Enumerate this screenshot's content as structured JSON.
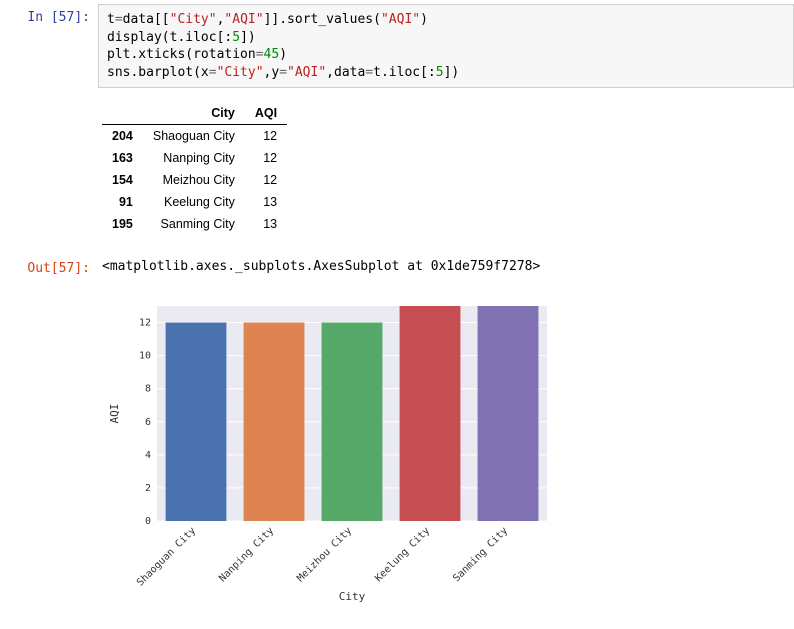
{
  "in_prompt": "In  [57]:",
  "out_prompt": "Out[57]:",
  "code_lines": [
    {
      "pre": "t",
      "op": "=",
      "mid": "data[[",
      "s1": "\"City\"",
      "c": ",",
      "s2": "\"AQI\"",
      "post": "]].sort_values(",
      "s3": "\"AQI\"",
      "end": ")"
    },
    {
      "raw": "display(t.iloc[:",
      "n": "5",
      "end": "])"
    },
    {
      "raw": "plt.xticks(rotation",
      "op": "=",
      "n": "45",
      "end": ")"
    },
    {
      "raw": "sns.barplot(x",
      "op": "=",
      "s1": "\"City\"",
      "c1": ",y",
      "op2": "=",
      "s2": "\"AQI\"",
      "c2": ",data",
      "op3": "=",
      "mid": "t.iloc[:",
      "n": "5",
      "end": "])"
    }
  ],
  "table": {
    "headers": [
      "",
      "City",
      "AQI"
    ],
    "rows": [
      {
        "idx": "204",
        "city": "Shaoguan City",
        "aqi": "12"
      },
      {
        "idx": "163",
        "city": "Nanping City",
        "aqi": "12"
      },
      {
        "idx": "154",
        "city": "Meizhou City",
        "aqi": "12"
      },
      {
        "idx": "91",
        "city": "Keelung City",
        "aqi": "13"
      },
      {
        "idx": "195",
        "city": "Sanming City",
        "aqi": "13"
      }
    ]
  },
  "repr_text": "<matplotlib.axes._subplots.AxesSubplot at 0x1de759f7278>",
  "chart_data": {
    "type": "bar",
    "categories": [
      "Shaoguan City",
      "Nanping City",
      "Meizhou City",
      "Keelung City",
      "Sanming City"
    ],
    "values": [
      12,
      12,
      12,
      13,
      13
    ],
    "title": "",
    "xlabel": "City",
    "ylabel": "AQI",
    "ylim": [
      0,
      13
    ],
    "yticks": [
      0,
      2,
      4,
      6,
      8,
      10,
      12
    ],
    "colors": [
      "#4C72B0",
      "#DD8452",
      "#55A868",
      "#C44E52",
      "#8172B3"
    ]
  }
}
